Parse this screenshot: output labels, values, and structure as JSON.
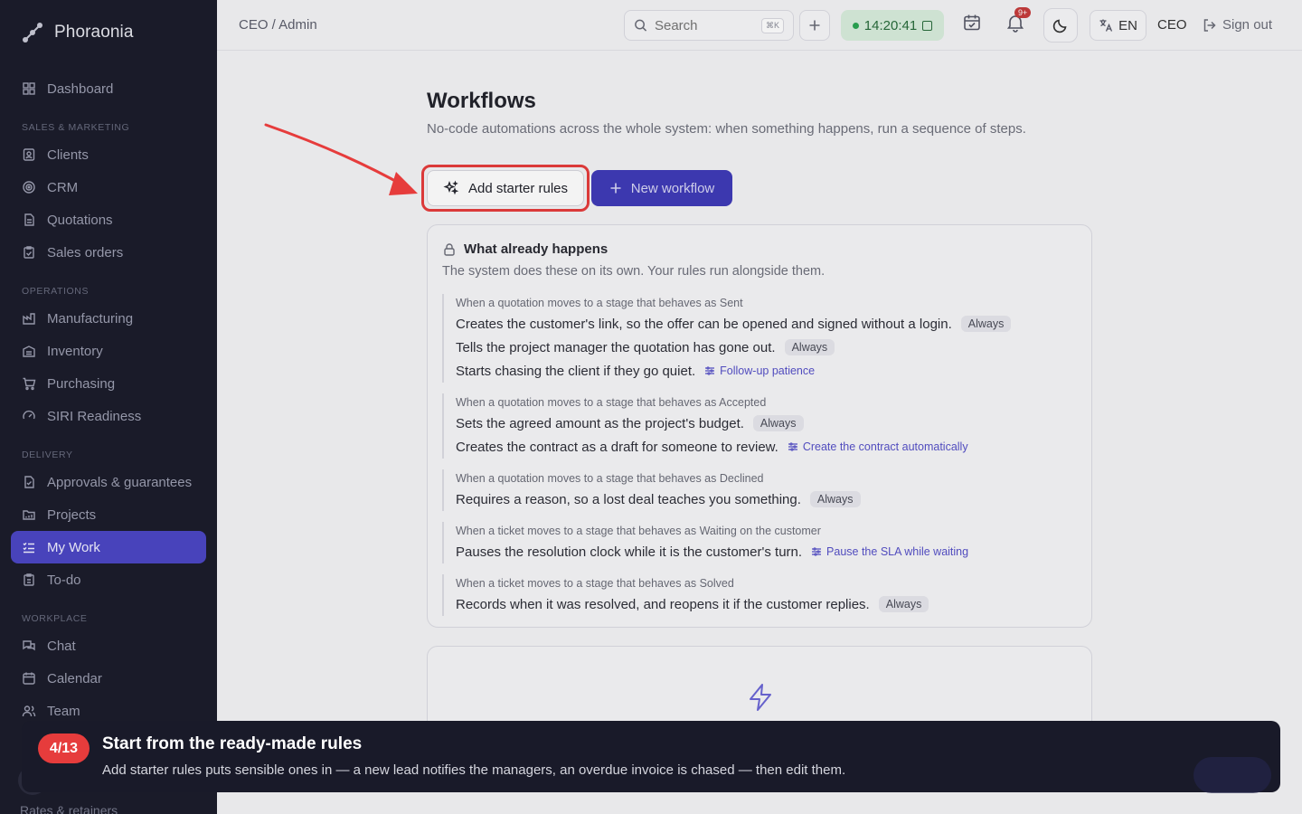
{
  "app": {
    "name": "Phoraonia"
  },
  "sidebar": {
    "sections": {
      "sales": "SALES & MARKETING",
      "operations": "OPERATIONS",
      "delivery": "DELIVERY",
      "workplace": "WORKPLACE"
    },
    "items": {
      "dashboard": "Dashboard",
      "clients": "Clients",
      "crm": "CRM",
      "quotations": "Quotations",
      "sales_orders": "Sales orders",
      "manufacturing": "Manufacturing",
      "inventory": "Inventory",
      "purchasing": "Purchasing",
      "siri": "SIRI Readiness",
      "approvals": "Approvals & guarantees",
      "projects": "Projects",
      "my_work": "My Work",
      "todo": "To-do",
      "chat": "Chat",
      "calendar": "Calendar",
      "team": "Team",
      "rates": "Rates & retainers"
    },
    "active_item": "My Work"
  },
  "topbar": {
    "breadcrumb": "CEO / Admin",
    "search_placeholder": "Search",
    "search_shortcut": "⌘K",
    "clock": "14:20:41",
    "notifications_badge": "9+",
    "language": "EN",
    "role": "CEO",
    "sign_out": "Sign out"
  },
  "page": {
    "title": "Workflows",
    "subtitle": "No-code automations across the whole system: when something happens, run a sequence of steps.",
    "add_starter_label": "Add starter rules",
    "new_workflow_label": "New workflow"
  },
  "existing": {
    "title": "What already happens",
    "subtitle": "The system does these on its own. Your rules run alongside them.",
    "groups": [
      {
        "when": "When a quotation moves to a stage that behaves as Sent",
        "rules": [
          {
            "text": "Creates the customer's link, so the offer can be opened and signed without a login.",
            "tag": "Always"
          },
          {
            "text": "Tells the project manager the quotation has gone out.",
            "tag": "Always"
          },
          {
            "text": "Starts chasing the client if they go quiet.",
            "setting": "Follow-up patience"
          }
        ]
      },
      {
        "when": "When a quotation moves to a stage that behaves as Accepted",
        "rules": [
          {
            "text": "Sets the agreed amount as the project's budget.",
            "tag": "Always"
          },
          {
            "text": "Creates the contract as a draft for someone to review.",
            "setting": "Create the contract automatically"
          }
        ]
      },
      {
        "when": "When a quotation moves to a stage that behaves as Declined",
        "rules": [
          {
            "text": "Requires a reason, so a lost deal teaches you something.",
            "tag": "Always"
          }
        ]
      },
      {
        "when": "When a ticket moves to a stage that behaves as Waiting on the customer",
        "rules": [
          {
            "text": "Pauses the resolution clock while it is the customer's turn.",
            "setting": "Pause the SLA while waiting"
          }
        ]
      },
      {
        "when": "When a ticket moves to a stage that behaves as Solved",
        "rules": [
          {
            "text": "Records when it was resolved, and reopens it if the customer replies.",
            "tag": "Always"
          }
        ]
      }
    ]
  },
  "tour": {
    "step": "4/13",
    "title": "Start from the ready-made rules",
    "body": "Add starter rules puts sensible ones in — a new lead notifies the managers, an overdue invoice is chased — then edit them."
  },
  "colors": {
    "accent": "#4b46c4",
    "highlight": "#e63c3c",
    "sidebar": "#1b1c2b"
  }
}
